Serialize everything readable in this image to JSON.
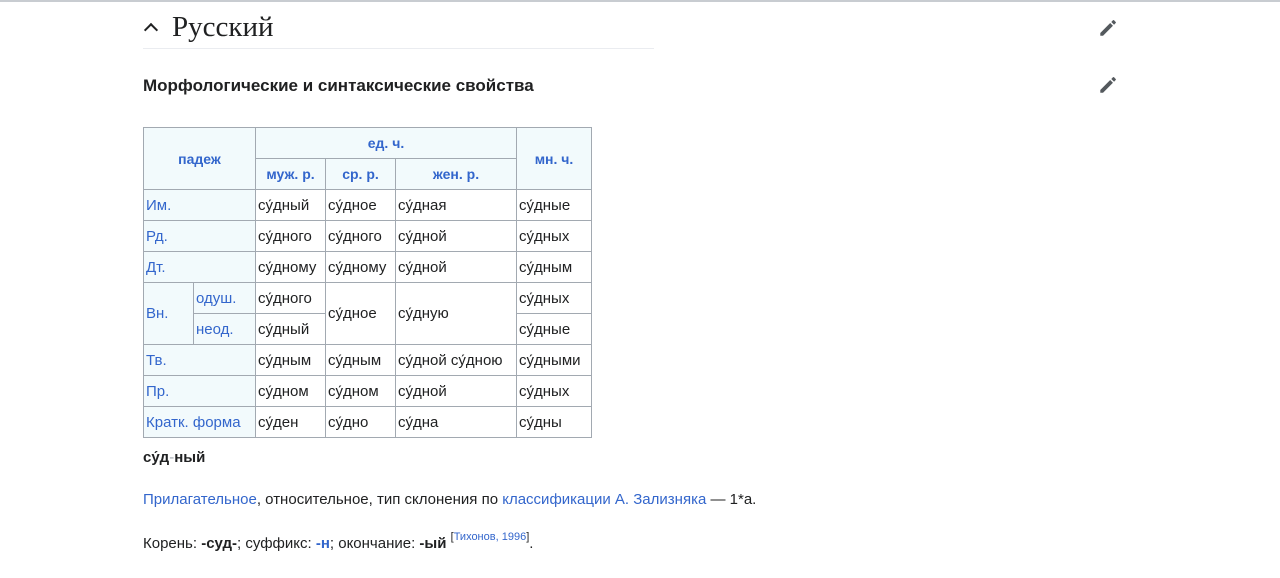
{
  "section": {
    "title": "Русский",
    "subsection_title": "Морфологические и синтаксические свойства"
  },
  "table": {
    "header_case": "падеж",
    "header_sing": "ед. ч.",
    "header_plural": "мн. ч.",
    "header_masc": "муж. р.",
    "header_neut": "ср. р.",
    "header_fem": "жен. р.",
    "rows": {
      "nom": {
        "label": "Им.",
        "m": "су́дный",
        "n": "су́дное",
        "f": "су́дная",
        "pl": "су́дные"
      },
      "gen": {
        "label": "Рд.",
        "m": "су́дного",
        "n": "су́дного",
        "f": "су́дной",
        "pl": "су́дных"
      },
      "dat": {
        "label": "Дт.",
        "m": "су́дному",
        "n": "су́дному",
        "f": "су́дной",
        "pl": "су́дным"
      },
      "acc": {
        "label": "Вн.",
        "anim_label": "одуш.",
        "inan_label": "неод.",
        "m_anim": "су́дного",
        "m_inan": "су́дный",
        "n": "су́дное",
        "f": "су́дную",
        "pl_anim": "су́дных",
        "pl_inan": "су́дные"
      },
      "ins": {
        "label": "Тв.",
        "m": "су́дным",
        "n": "су́дным",
        "f": "су́дной су́дною",
        "pl": "су́дными"
      },
      "pre": {
        "label": "Пр.",
        "m": "су́дном",
        "n": "су́дном",
        "f": "су́дной",
        "pl": "су́дных"
      },
      "short": {
        "label": "Кратк. форма",
        "m": "су́ден",
        "n": "су́дно",
        "f": "су́дна",
        "pl": "су́дны"
      }
    }
  },
  "syllables": {
    "part1": "су́д",
    "separator": "-",
    "part2": "ный"
  },
  "description": {
    "pos_link": "Прилагательное",
    "text1": ", относительное, тип склонения по ",
    "class_link": "классификации А. Зализняка",
    "text2": " — 1*a."
  },
  "morphemes": {
    "root_label": "Корень: ",
    "root": "-суд-",
    "suffix_label": "; суффикс: ",
    "suffix": "-н",
    "ending_label": "; окончание: ",
    "ending": "-ый",
    "ref_open": "[",
    "ref": "Тихонов, 1996",
    "ref_close": "]",
    "end": "."
  },
  "icons": {
    "edit": "pencil-icon",
    "collapse": "chevron-up-icon"
  },
  "colors": {
    "link": "#3366cc",
    "header_bg": "#f2fafc",
    "border": "#a2a9b1",
    "text": "#202122"
  }
}
